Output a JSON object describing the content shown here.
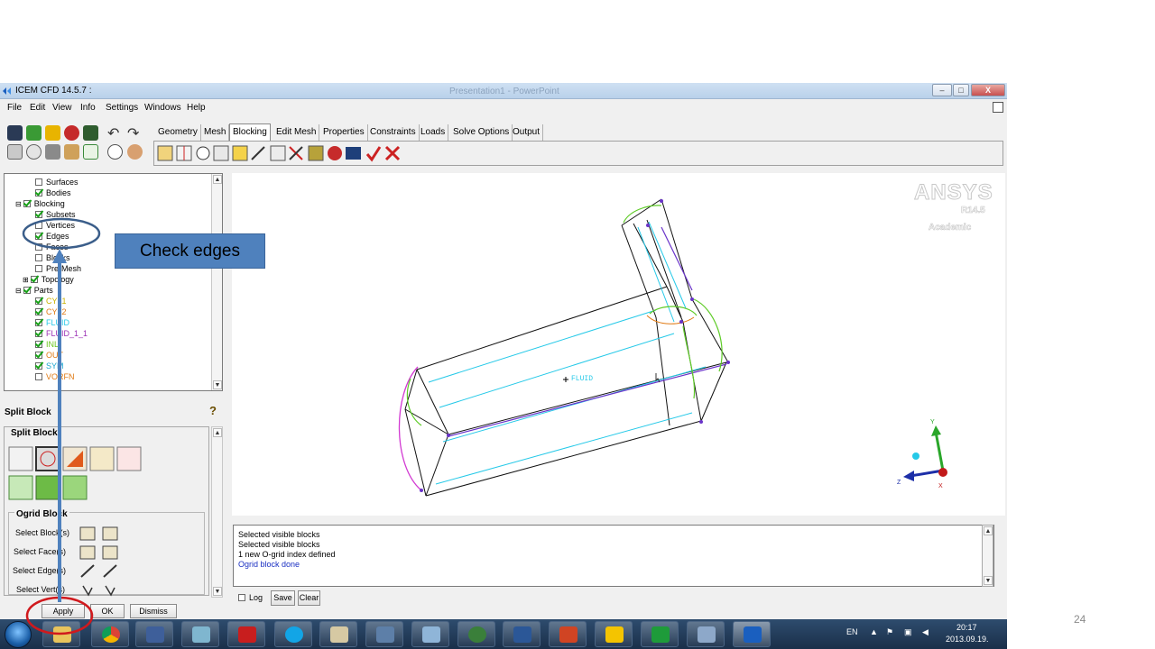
{
  "window": {
    "title": "ICEM CFD 14.5.7 :",
    "background_title": "Presentation1 - PowerPoint",
    "minimize": "–",
    "maximize": "□",
    "close": "X"
  },
  "menu": [
    "File",
    "Edit",
    "View",
    "Info",
    "Settings",
    "Windows",
    "Help"
  ],
  "tabs": [
    "Geometry",
    "Mesh",
    "Blocking",
    "Edit Mesh",
    "Properties",
    "Constraints",
    "Loads",
    "Solve Options",
    "Output"
  ],
  "active_tab": "Blocking",
  "tree": {
    "surfaces": "Surfaces",
    "bodies": "Bodies",
    "blocking": "Blocking",
    "subsets": "Subsets",
    "vertices": "Vertices",
    "edges": "Edges",
    "faces": "Faces",
    "blocks": "Blocks",
    "premesh": "Pre-Mesh",
    "topology": "Topology",
    "parts": "Parts",
    "part_items": [
      {
        "label": "CYL1",
        "color": "#c9b200"
      },
      {
        "label": "CYL2",
        "color": "#e07a14"
      },
      {
        "label": "FLUID",
        "color": "#25c9e8"
      },
      {
        "label": "FLUID_1_1",
        "color": "#9b2fb4"
      },
      {
        "label": "INL",
        "color": "#6bc71f"
      },
      {
        "label": "OUT",
        "color": "#e07a14"
      },
      {
        "label": "SYM",
        "color": "#1aa6cf"
      },
      {
        "label": "VORFN",
        "color": "#e07a14"
      }
    ]
  },
  "panel": {
    "title": "Split Block",
    "section": "Split Block",
    "ogrid_title": "Ogrid Block",
    "rows": [
      "Select Block(s)",
      "Select Face(s)",
      "Select Edge(s)",
      "Select Vert(s)"
    ],
    "apply": "Apply",
    "ok": "OK",
    "dismiss": "Dismiss",
    "help": "?"
  },
  "viewport": {
    "logo": "ANSYS",
    "version": "R14.5",
    "edition": "Academic",
    "label_fluid": "FLUID",
    "axis_x": "X",
    "axis_y": "Y",
    "axis_z": "Z"
  },
  "log": {
    "lines": [
      "Selected visible blocks",
      "Selected visible blocks",
      "1 new O-grid index defined",
      "Ogrid block done"
    ],
    "log_label": "Log",
    "save": "Save",
    "clear": "Clear"
  },
  "taskbar": {
    "lang": "EN",
    "time": "20:17",
    "date": "2013.09.19."
  },
  "annotation": {
    "callout": "Check edges"
  },
  "slide_number": "24"
}
